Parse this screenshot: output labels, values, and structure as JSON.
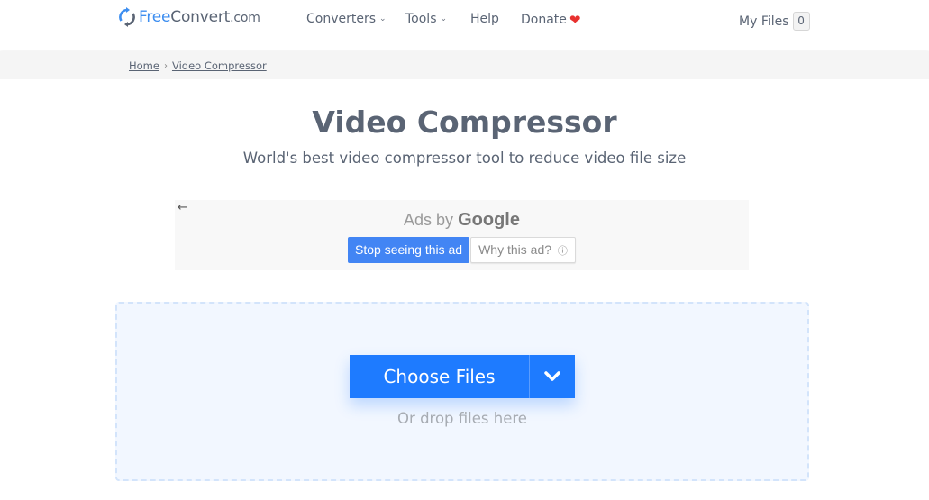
{
  "header": {
    "logo": {
      "free": "Free",
      "convert": "Convert",
      "com": ".com"
    },
    "nav": [
      {
        "label": "Converters",
        "has_dropdown": true
      },
      {
        "label": "Tools",
        "has_dropdown": true
      },
      {
        "label": "Help",
        "has_dropdown": false
      },
      {
        "label": "Donate",
        "icon": "heart-icon"
      }
    ],
    "my_files": {
      "label": "My Files",
      "count": "0"
    }
  },
  "breadcrumb": [
    {
      "label": "Home"
    },
    {
      "label": "Video Compressor"
    }
  ],
  "page": {
    "title": "Video Compressor",
    "subtitle": "World's best video compressor tool to reduce video file size"
  },
  "ad": {
    "back_icon": "←",
    "ads_by": "Ads by",
    "brand": "Google",
    "stop_label": "Stop seeing this ad",
    "why_label": "Why this ad?",
    "info_icon": "ⓘ"
  },
  "upload": {
    "choose_label": "Choose Files",
    "drop_label": "Or drop files here"
  },
  "colors": {
    "accent": "#1e7bff",
    "text": "#5a6474",
    "heart": "#e8312f",
    "ad_button": "#4285f4"
  }
}
